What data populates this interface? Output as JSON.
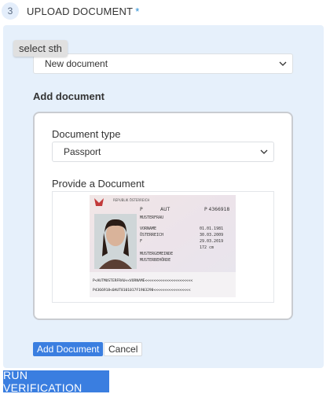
{
  "step": {
    "number": "3",
    "title": "UPLOAD DOCUMENT",
    "required_mark": "*"
  },
  "tooltip": {
    "text": "select sth"
  },
  "source_select": {
    "value": "New document"
  },
  "section": {
    "title": "Add document"
  },
  "document_type": {
    "label": "Document type",
    "value": "Passport"
  },
  "provide": {
    "label": "Provide a Document",
    "passport_lines": {
      "header_small": "REPUBLIK ÖSTERREICH",
      "field_type": "P",
      "field_code": "AUT",
      "field_number": "P 4366918",
      "surname": "MUSTERFRAU",
      "given": "VORNAME",
      "nationality": "ÖSTERREICH",
      "dob": "01.01.1981",
      "sex": "F",
      "issue": "30.03.2009",
      "expiry": "29.03.2019",
      "height": "172 cm",
      "place": "MUSTERGEMEINDE",
      "authority": "MUSTERBEHÖRDE",
      "mrz1": "P<AUTMUSTERFRAU<<VORNAME<<<<<<<<<<<<<<<<<<<<<<",
      "mrz2": "P4366918<0AUT8101017F1903290<<<<<<<<<<<<<<<<<"
    }
  },
  "buttons": {
    "add": "Add Document",
    "cancel": "Cancel",
    "run": "RUN VERIFICATION"
  },
  "colors": {
    "accent": "#3a7ee0",
    "panel_bg": "#e6f0fb",
    "required": "#2a8fd6"
  }
}
